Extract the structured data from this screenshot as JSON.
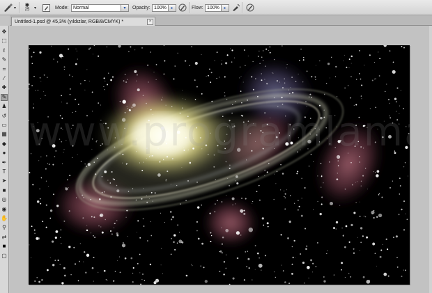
{
  "options_bar": {
    "brush_size": "25",
    "mode_label": "Mode:",
    "mode_value": "Normal",
    "opacity_label": "Opacity:",
    "opacity_value": "100%",
    "flow_label": "Flow:",
    "flow_value": "100%"
  },
  "document": {
    "tab_title": "Untitled-1.psd @ 45,3% (yıldızlar, RGB/8/CMYK) *",
    "close_glyph": "×"
  },
  "canvas": {
    "watermark": "www.programlama.com"
  },
  "tools": [
    {
      "name": "move-tool",
      "glyph": "✥"
    },
    {
      "name": "marquee-tool",
      "glyph": "⬚"
    },
    {
      "name": "lasso-tool",
      "glyph": "ℓ"
    },
    {
      "name": "quick-select-tool",
      "glyph": "✎"
    },
    {
      "name": "crop-tool",
      "glyph": "⌗"
    },
    {
      "name": "eyedropper-tool",
      "glyph": "⁄"
    },
    {
      "name": "healing-tool",
      "glyph": "✚"
    },
    {
      "name": "brush-tool",
      "glyph": "✎"
    },
    {
      "name": "clone-stamp-tool",
      "glyph": "♟"
    },
    {
      "name": "history-brush-tool",
      "glyph": "↺"
    },
    {
      "name": "eraser-tool",
      "glyph": "▭"
    },
    {
      "name": "gradient-tool",
      "glyph": "▦"
    },
    {
      "name": "blur-tool",
      "glyph": "◆"
    },
    {
      "name": "dodge-tool",
      "glyph": "●"
    },
    {
      "name": "pen-tool",
      "glyph": "✒"
    },
    {
      "name": "type-tool",
      "glyph": "T"
    },
    {
      "name": "path-select-tool",
      "glyph": "➤"
    },
    {
      "name": "shape-tool",
      "glyph": "■"
    },
    {
      "name": "3d-rotate-tool",
      "glyph": "◎"
    },
    {
      "name": "3d-camera-tool",
      "glyph": "◉"
    },
    {
      "name": "hand-tool",
      "glyph": "✋"
    },
    {
      "name": "zoom-tool",
      "glyph": "⚲"
    },
    {
      "name": "swap-colors",
      "glyph": "⇄"
    },
    {
      "name": "foreground-color",
      "glyph": "■"
    },
    {
      "name": "quick-mask",
      "glyph": "▢"
    }
  ],
  "colors": {
    "foreground": "#000000",
    "background": "#ffffff",
    "accent": "#1d4fa6"
  }
}
